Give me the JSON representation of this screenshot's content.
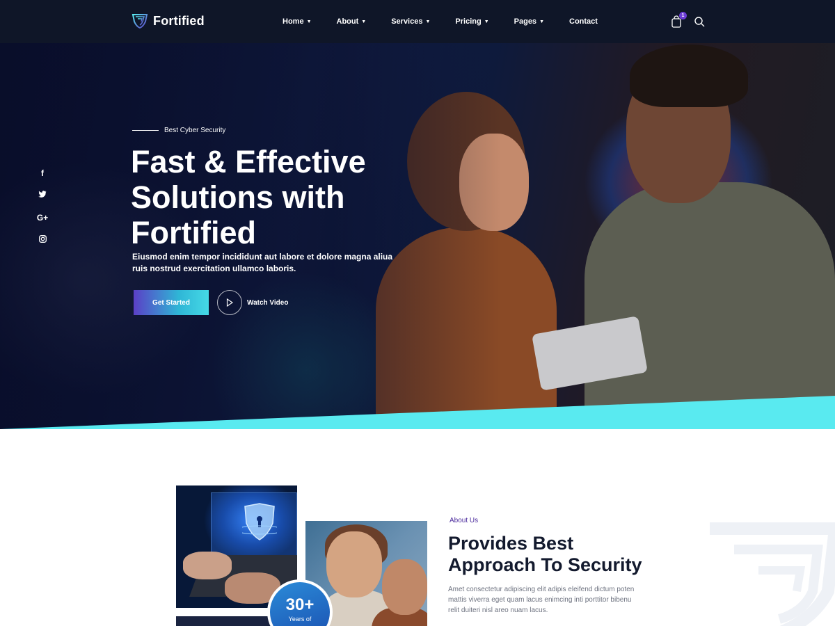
{
  "brand": {
    "name": "Fortified"
  },
  "nav": {
    "items": [
      {
        "label": "Home",
        "has_dropdown": true
      },
      {
        "label": "About",
        "has_dropdown": true
      },
      {
        "label": "Services",
        "has_dropdown": true
      },
      {
        "label": "Pricing",
        "has_dropdown": true
      },
      {
        "label": "Pages",
        "has_dropdown": true
      },
      {
        "label": "Contact",
        "has_dropdown": false
      }
    ],
    "cart_count": "1",
    "cart_icon": "shopping-bag-icon",
    "search_icon": "search-icon"
  },
  "hero": {
    "tagline": "Best Cyber Security",
    "title_lines": [
      "Fast & Effective",
      "Solutions with",
      "Fortified"
    ],
    "description_lines": [
      "Eiusmod enim tempor incididunt aut labore et dolore magna aliua",
      "ruis nostrud exercitation ullamco laboris."
    ],
    "cta_label": "Get Started",
    "video_label": "Watch Video"
  },
  "social": [
    {
      "icon": "facebook-icon",
      "glyph": "f"
    },
    {
      "icon": "twitter-icon",
      "glyph": "🐦"
    },
    {
      "icon": "google-plus-icon",
      "glyph": "G+"
    },
    {
      "icon": "instagram-icon",
      "glyph": "◎"
    }
  ],
  "about": {
    "label": "About Us",
    "title_lines": [
      "Provides Best",
      "Approach To Security"
    ],
    "description_lines": [
      "Amet consectetur adipiscing elit adipis eleifend dictum poten",
      "mattis viverra eget quam lacus enimcing inti porttitor bibenu",
      "relit duiteri nisl areo nuam lacus."
    ],
    "badge_number": "30+",
    "badge_text": "Years of"
  },
  "colors": {
    "nav_bg": "#0f1628",
    "accent_cyan": "#59eaf0",
    "accent_purple": "#5b3fc6",
    "heading_dark": "#131a2e",
    "label_purple": "#4a2a9c"
  }
}
